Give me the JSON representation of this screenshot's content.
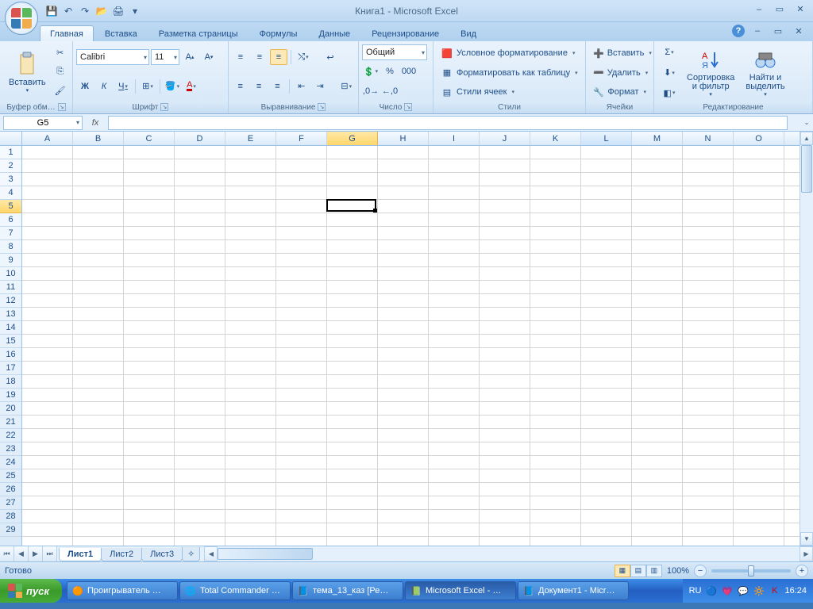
{
  "app": {
    "title": "Книга1 - Microsoft Excel"
  },
  "qat": {
    "save": "💾",
    "undo": "↶",
    "redo": "↷",
    "open": "📂",
    "print": "🖨"
  },
  "tabs": {
    "home": "Главная",
    "insert": "Вставка",
    "layout": "Разметка страницы",
    "formulas": "Формулы",
    "data": "Данные",
    "review": "Рецензирование",
    "view": "Вид"
  },
  "ribbon": {
    "clipboard": {
      "label": "Буфер обм…",
      "paste": "Вставить"
    },
    "font": {
      "label": "Шрифт",
      "name": "Calibri",
      "size": "11",
      "bold": "Ж",
      "italic": "К",
      "underline": "Ч"
    },
    "alignment": {
      "label": "Выравнивание"
    },
    "number": {
      "label": "Число",
      "format": "Общий"
    },
    "styles": {
      "label": "Стили",
      "conditional": "Условное форматирование",
      "table": "Форматировать как таблицу",
      "cell": "Стили ячеек"
    },
    "cells": {
      "label": "Ячейки",
      "insert": "Вставить",
      "delete": "Удалить",
      "format": "Формат"
    },
    "editing": {
      "label": "Редактирование",
      "sort": "Сортировка\nи фильтр",
      "find": "Найти и\nвыделить"
    }
  },
  "namebox": "G5",
  "fx": "fx",
  "columns": [
    "A",
    "B",
    "C",
    "D",
    "E",
    "F",
    "G",
    "H",
    "I",
    "J",
    "K",
    "L",
    "M",
    "N",
    "O"
  ],
  "rows": [
    "1",
    "2",
    "3",
    "4",
    "5",
    "6",
    "7",
    "8",
    "9",
    "10",
    "11",
    "12",
    "13",
    "14",
    "15",
    "16",
    "17",
    "18",
    "19",
    "20",
    "21",
    "22",
    "23",
    "24",
    "25",
    "26",
    "27",
    "28",
    "29"
  ],
  "selected": {
    "col": 6,
    "row": 4,
    "hover_col": 11
  },
  "sheets": {
    "s1": "Лист1",
    "s2": "Лист2",
    "s3": "Лист3"
  },
  "status": {
    "ready": "Готово",
    "zoom": "100%"
  },
  "taskbar": {
    "start": "пуск",
    "items": [
      {
        "icon": "🟠",
        "label": "Проигрыватель …"
      },
      {
        "icon": "🌐",
        "label": "Total Commander …"
      },
      {
        "icon": "📘",
        "label": "тема_13_каз [Ре…"
      },
      {
        "icon": "📗",
        "label": "Microsoft Excel - …"
      },
      {
        "icon": "📘",
        "label": "Документ1 - Micr…"
      }
    ],
    "lang": "RU",
    "time": "16:24"
  }
}
